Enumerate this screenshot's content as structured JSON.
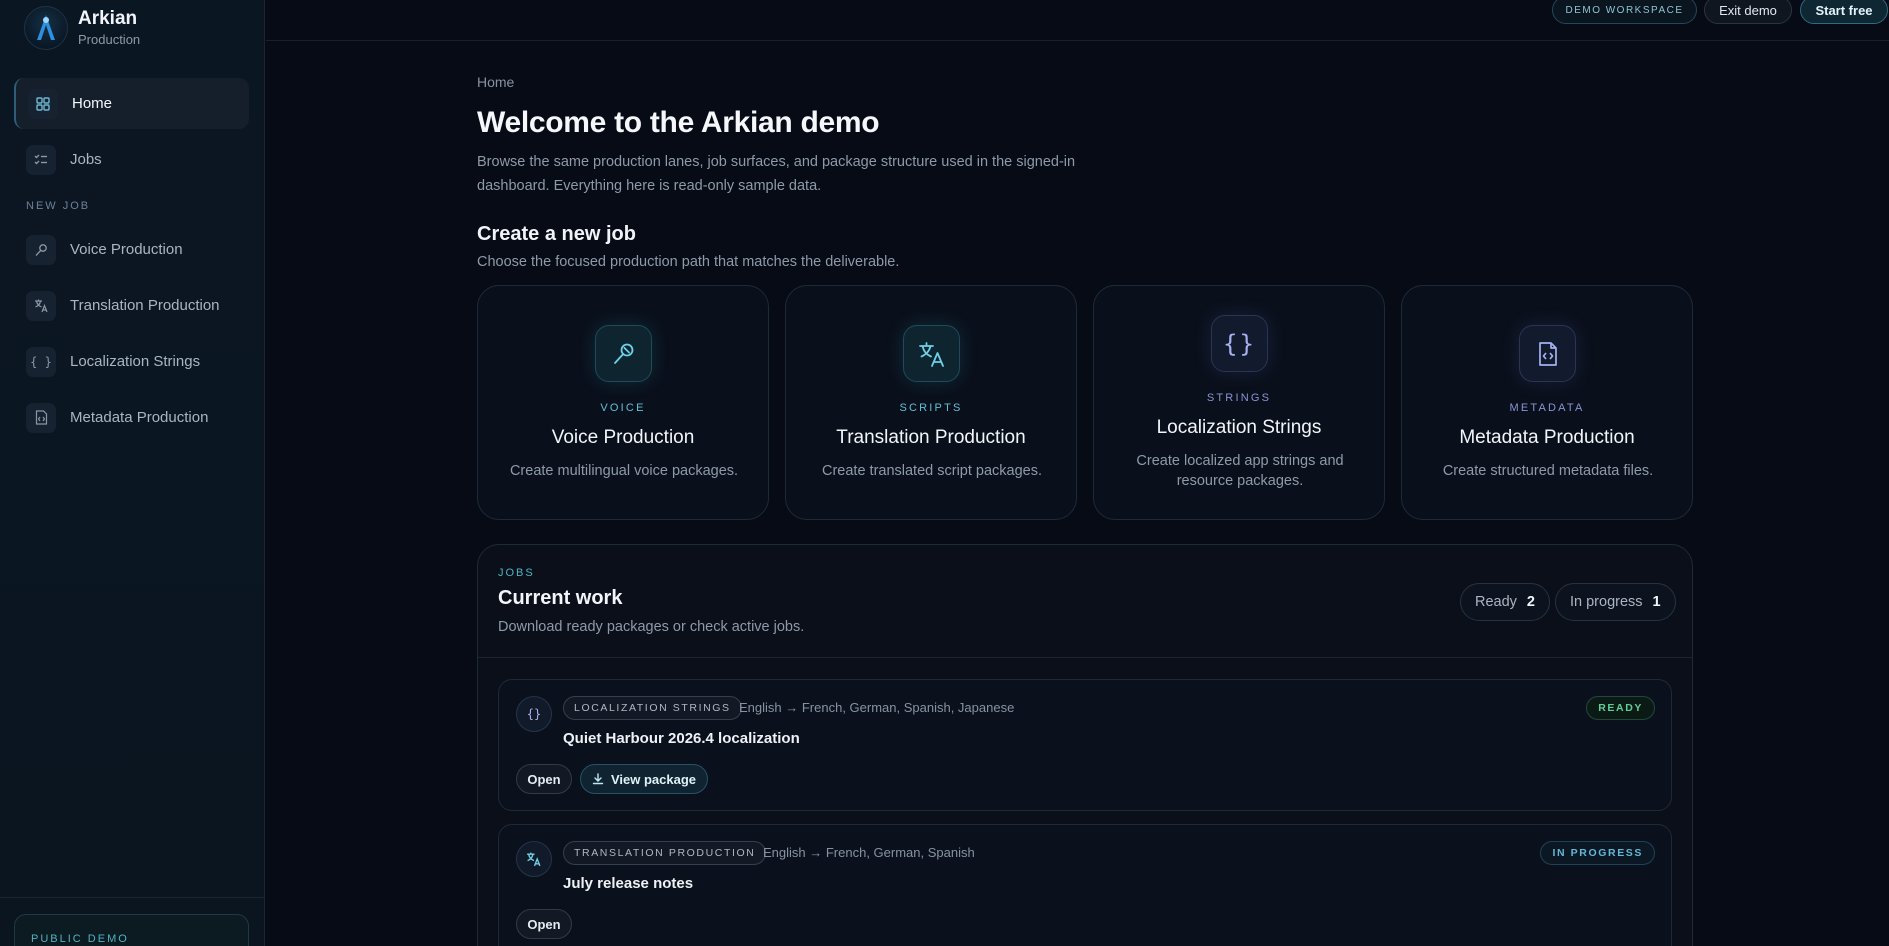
{
  "brand": {
    "name": "Arkian",
    "subtitle": "Production",
    "icon": "arkian-logo-icon"
  },
  "sidebar": {
    "items": [
      {
        "label": "Home",
        "icon": "grid-icon",
        "active": true
      },
      {
        "label": "Jobs",
        "icon": "checklist-icon",
        "active": false
      }
    ],
    "section_label": "NEW JOB",
    "new_job_items": [
      {
        "label": "Voice Production",
        "icon": "microphone-icon"
      },
      {
        "label": "Translation Production",
        "icon": "translate-icon"
      },
      {
        "label": "Localization Strings",
        "icon": "braces-icon"
      },
      {
        "label": "Metadata Production",
        "icon": "file-code-icon"
      }
    ],
    "footer_label": "PUBLIC DEMO"
  },
  "topbar": {
    "workspace_badge": "DEMO WORKSPACE",
    "exit_label": "Exit demo",
    "start_label": "Start free"
  },
  "main": {
    "breadcrumb": "Home",
    "title": "Welcome to the Arkian demo",
    "description": "Browse the same production lanes, job surfaces, and package structure used in the signed-in dashboard. Everything here is read-only sample data.",
    "create_title": "Create a new job",
    "create_desc": "Choose the focused production path that matches the deliverable.",
    "cards": [
      {
        "kicker": "VOICE",
        "title": "Voice Production",
        "desc": "Create multilingual voice packages.",
        "icon": "microphone-icon",
        "accent": "#5fbfd6"
      },
      {
        "kicker": "SCRIPTS",
        "title": "Translation Production",
        "desc": "Create translated script packages.",
        "icon": "translate-icon",
        "accent": "#5fbfd6"
      },
      {
        "kicker": "STRINGS",
        "title": "Localization Strings",
        "desc": "Create localized app strings and resource packages.",
        "icon": "braces-icon",
        "accent": "#8a93d6"
      },
      {
        "kicker": "METADATA",
        "title": "Metadata Production",
        "desc": "Create structured metadata files.",
        "icon": "file-code-icon",
        "accent": "#8a93d6"
      }
    ]
  },
  "jobs": {
    "kicker": "JOBS",
    "title": "Current work",
    "desc": "Download ready packages or check active jobs.",
    "ready_label": "Ready",
    "ready_count": "2",
    "progress_label": "In progress",
    "progress_count": "1",
    "items": [
      {
        "type": "LOCALIZATION STRINGS",
        "langs": "English → French, German, Spanish, Japanese",
        "name": "Quiet Harbour 2026.4 localization",
        "status": "READY",
        "open_label": "Open",
        "view_label": "View package",
        "icon": "braces-icon"
      },
      {
        "type": "TRANSLATION PRODUCTION",
        "langs": "English → French, German, Spanish",
        "name": "July release notes",
        "status": "IN PROGRESS",
        "open_label": "Open",
        "icon": "translate-icon"
      }
    ]
  },
  "colors": {
    "accent_teal": "#4fb3c0",
    "ready_green": "#5fcf98",
    "background": "#070b16"
  }
}
